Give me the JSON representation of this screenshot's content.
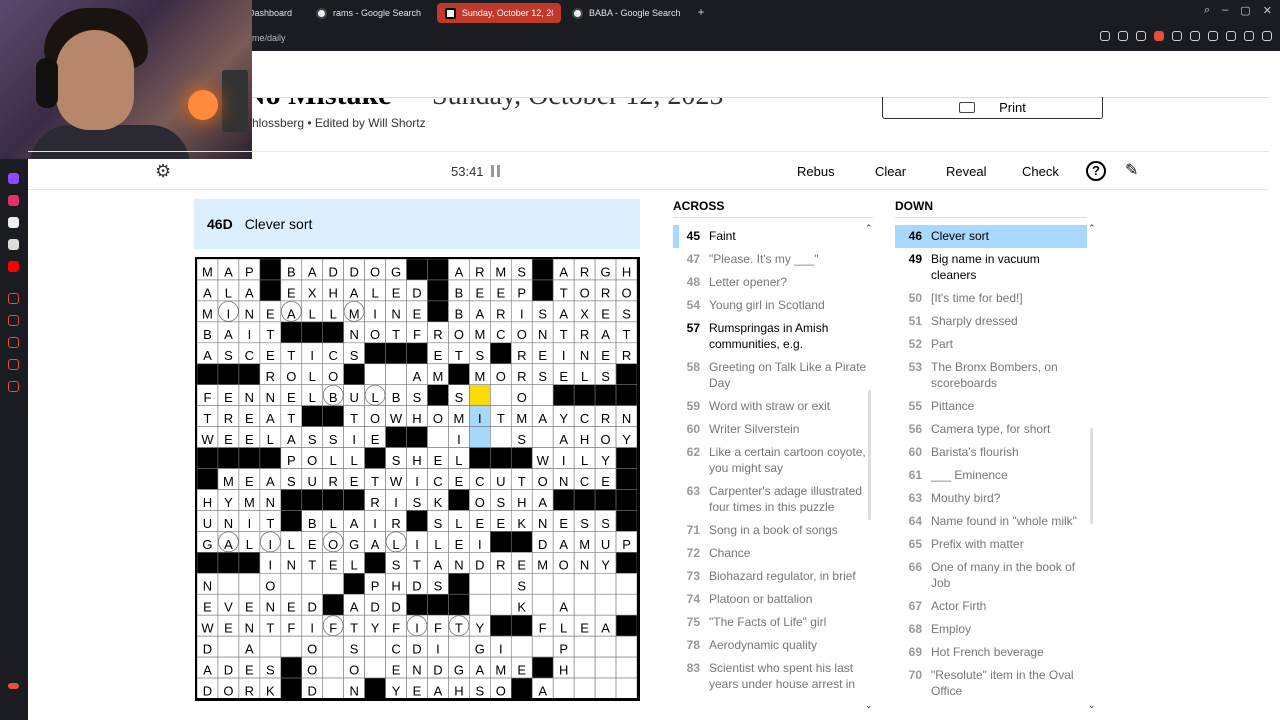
{
  "browser": {
    "tabs": [
      {
        "label": "Dashboard",
        "active": false
      },
      {
        "label": "rams - Google Search",
        "active": false
      },
      {
        "label": "Sunday, October 12, 2025",
        "active": true
      },
      {
        "label": "BABA - Google Search",
        "active": false
      }
    ],
    "url": "me/daily"
  },
  "puzzle": {
    "title": "No Mistake",
    "date": "Sunday, October 12, 2025",
    "byline": "hlossberg  •  Edited by Will Shortz",
    "print_label": "Print"
  },
  "toolbar": {
    "timer": "53:41",
    "rebus": "Rebus",
    "clear": "Clear",
    "reveal": "Reveal",
    "check": "Check",
    "help": "?"
  },
  "current_clue": {
    "number": "46D",
    "text": "Clever sort"
  },
  "grid_rows": [
    "MAP#BADDOG##ARMS#ARGH",
    "ALA#EXHALED#BEEP#TORO",
    "MINEALLMINE#BARISAXES",
    "BAIT###NOTFROMCONTRATE",
    "ASCETICS####ETS#REINER",
    "#####ROLO#####AM#MORSELS",
    "FENNELBULBS#S##O#######",
    "TREAT##TOWHOMITMAYCRN#",
    "WEELASSIE###I##S#AHOY",
    "###POLL#SHEL###WILY#",
    "#MEASURETWICECUTONCE#",
    "HYMN####RISK#OSHA###",
    "UNIT#BLAIR#SLEEKNESS",
    "GALILEOGALILEI##DAMUP",
    "###INTEL#STANDREMONY#",
    "N##O#######PHDS##S####",
    "EVENED#ADD########K#A##",
    "WENTFIFTYFIFTY####FLEA",
    "D##A###O##O####CDI#GI##P",
    "ADES#O#O#ENDGAME#H##",
    "DORK#D##N#YEAHSO#A###"
  ],
  "grid": {
    "letters": [
      [
        "M",
        "A",
        "P",
        "#",
        "B",
        "A",
        "D",
        "D",
        "O",
        "G",
        "#",
        "#",
        "A",
        "R",
        "M",
        "S",
        "#",
        "A",
        "R",
        "G",
        "H"
      ],
      [
        "A",
        "L",
        "A",
        "#",
        "E",
        "X",
        "H",
        "A",
        "L",
        "E",
        "D",
        "#",
        "B",
        "E",
        "E",
        "P",
        "#",
        "T",
        "O",
        "R",
        "O"
      ],
      [
        "M",
        "I",
        "N",
        "E",
        "A",
        "L",
        "L",
        "M",
        "I",
        "N",
        "E",
        "#",
        "B",
        "A",
        "R",
        "I",
        "S",
        "A",
        "X",
        "E",
        "S"
      ],
      [
        "B",
        "A",
        "I",
        "T",
        "#",
        "#",
        "#",
        "N",
        "O",
        "T",
        "F",
        "R",
        "O",
        "M",
        "C",
        "O",
        "N",
        "T",
        "R",
        "A",
        "T",
        "E"
      ],
      [
        "A",
        "S",
        "C",
        "E",
        "T",
        "I",
        "C",
        "S",
        "#",
        "#",
        "#",
        "E",
        "T",
        "S",
        "#",
        "R",
        "E",
        "I",
        "N",
        "E",
        "R"
      ],
      [
        "#",
        "#",
        "#",
        "R",
        "O",
        "L",
        "O",
        "#",
        "",
        "",
        "A",
        "M",
        "#",
        "M",
        "O",
        "R",
        "S",
        "E",
        "L",
        "S",
        "#"
      ],
      [
        "F",
        "E",
        "N",
        "N",
        "E",
        "L",
        "B",
        "U",
        "L",
        "B",
        "S",
        "#",
        "S",
        "",
        "",
        "O",
        "",
        "#",
        "#",
        "#",
        "#"
      ],
      [
        "T",
        "R",
        "E",
        "A",
        "T",
        "#",
        "#",
        "T",
        "O",
        "W",
        "H",
        "O",
        "M",
        "I",
        "T",
        "M",
        "A",
        "Y",
        "C",
        "R",
        "N"
      ],
      [
        "W",
        "E",
        "E",
        "L",
        "A",
        "S",
        "S",
        "I",
        "E",
        "#",
        "#",
        "",
        "I",
        "",
        "",
        "S",
        "",
        "A",
        "H",
        "O",
        "Y"
      ],
      [
        "#",
        "#",
        "#",
        "#",
        "P",
        "O",
        "L",
        "L",
        "#",
        "S",
        "H",
        "E",
        "L",
        "#",
        "#",
        "#",
        "W",
        "I",
        "L",
        "Y",
        "#"
      ],
      [
        "#",
        "M",
        "E",
        "A",
        "S",
        "U",
        "R",
        "E",
        "T",
        "W",
        "I",
        "C",
        "E",
        "C",
        "U",
        "T",
        "O",
        "N",
        "C",
        "E",
        "#"
      ],
      [
        "H",
        "Y",
        "M",
        "N",
        "#",
        "#",
        "#",
        "#",
        "R",
        "I",
        "S",
        "K",
        "#",
        "O",
        "S",
        "H",
        "A",
        "#",
        "#",
        "#",
        "#"
      ],
      [
        "U",
        "N",
        "I",
        "T",
        "#",
        "B",
        "L",
        "A",
        "I",
        "R",
        "#",
        "S",
        "L",
        "E",
        "E",
        "K",
        "N",
        "E",
        "S",
        "S",
        "#"
      ],
      [
        "G",
        "A",
        "L",
        "I",
        "L",
        "E",
        "O",
        "G",
        "A",
        "L",
        "I",
        "L",
        "E",
        "I",
        "#",
        "#",
        "D",
        "A",
        "M",
        "U",
        "P"
      ],
      [
        "#",
        "#",
        "#",
        "I",
        "N",
        "T",
        "E",
        "L",
        "#",
        "S",
        "T",
        "A",
        "N",
        "D",
        "R",
        "E",
        "M",
        "O",
        "N",
        "Y",
        "#"
      ],
      [
        "N",
        "",
        "",
        "O",
        "",
        "",
        "",
        "#",
        "P",
        "H",
        "D",
        "S",
        "#",
        "",
        "",
        "S",
        "",
        "",
        "",
        "",
        ""
      ],
      [
        "E",
        "V",
        "E",
        "N",
        "E",
        "D",
        "#",
        "A",
        "D",
        "D",
        "#",
        "#",
        "#",
        "",
        "",
        "K",
        "",
        "A",
        "",
        "",
        ""
      ],
      [
        "W",
        "E",
        "N",
        "T",
        "F",
        "I",
        "F",
        "T",
        "Y",
        "F",
        "I",
        "F",
        "T",
        "Y",
        "#",
        "#",
        "F",
        "L",
        "E",
        "A",
        "#"
      ],
      [
        "D",
        "",
        "A",
        "",
        "",
        "O",
        "",
        "S",
        "",
        "C",
        "D",
        "I",
        "",
        "G",
        "I",
        "",
        "",
        "P",
        "",
        "",
        ""
      ],
      [
        "A",
        "D",
        "E",
        "S",
        "#",
        "O",
        "",
        "O",
        "",
        "E",
        "N",
        "D",
        "G",
        "A",
        "M",
        "E",
        "#",
        "H",
        "",
        "",
        ""
      ],
      [
        "D",
        "O",
        "R",
        "K",
        "#",
        "D",
        "",
        "N",
        "#",
        "Y",
        "E",
        "A",
        "H",
        "S",
        "O",
        "#",
        "A",
        "",
        "",
        "",
        ""
      ]
    ]
  },
  "across": {
    "header": "ACROSS",
    "clues": [
      {
        "n": "45",
        "t": "Faint",
        "state": "cross"
      },
      {
        "n": "47",
        "t": "\"Please. It's my ___\"",
        "state": ""
      },
      {
        "n": "48",
        "t": "Letter opener?",
        "state": ""
      },
      {
        "n": "54",
        "t": "Young girl in Scotland",
        "state": ""
      },
      {
        "n": "57",
        "t": "Rumspringas in Amish communities, e.g.",
        "state": "done"
      },
      {
        "n": "58",
        "t": "Greeting on Talk Like a Pirate Day",
        "state": ""
      },
      {
        "n": "59",
        "t": "Word with straw or exit",
        "state": ""
      },
      {
        "n": "60",
        "t": "Writer Silverstein",
        "state": ""
      },
      {
        "n": "62",
        "t": "Like a certain cartoon coyote, you might say",
        "state": ""
      },
      {
        "n": "63",
        "t": "Carpenter's adage illustrated four times in this puzzle",
        "state": ""
      },
      {
        "n": "71",
        "t": "Song in a book of songs",
        "state": ""
      },
      {
        "n": "72",
        "t": "Chance",
        "state": ""
      },
      {
        "n": "73",
        "t": "Biohazard regulator, in brief",
        "state": ""
      },
      {
        "n": "74",
        "t": "Platoon or battalion",
        "state": ""
      },
      {
        "n": "75",
        "t": "\"The Facts of Life\" girl",
        "state": ""
      },
      {
        "n": "78",
        "t": "Aerodynamic quality",
        "state": ""
      },
      {
        "n": "83",
        "t": "Scientist who spent his last years under house arrest in",
        "state": ""
      }
    ]
  },
  "down": {
    "header": "DOWN",
    "clues": [
      {
        "n": "46",
        "t": "Clever sort",
        "state": "sel"
      },
      {
        "n": "49",
        "t": "Big name in vacuum cleaners",
        "state": "done"
      },
      {
        "n": "50",
        "t": "[It's time for bed!]",
        "state": ""
      },
      {
        "n": "51",
        "t": "Sharply dressed",
        "state": ""
      },
      {
        "n": "52",
        "t": "Part",
        "state": ""
      },
      {
        "n": "53",
        "t": "The Bronx Bombers, on scoreboards",
        "state": ""
      },
      {
        "n": "55",
        "t": "Pittance",
        "state": ""
      },
      {
        "n": "56",
        "t": "Camera type, for short",
        "state": ""
      },
      {
        "n": "60",
        "t": "Barista's flourish",
        "state": ""
      },
      {
        "n": "61",
        "t": "___ Eminence",
        "state": ""
      },
      {
        "n": "63",
        "t": "Mouthy bird?",
        "state": ""
      },
      {
        "n": "64",
        "t": "Name found in \"whole milk\"",
        "state": ""
      },
      {
        "n": "65",
        "t": "Prefix with matter",
        "state": ""
      },
      {
        "n": "66",
        "t": "One of many in the book of Job",
        "state": ""
      },
      {
        "n": "67",
        "t": "Actor Firth",
        "state": ""
      },
      {
        "n": "68",
        "t": "Employ",
        "state": ""
      },
      {
        "n": "69",
        "t": "Hot French beverage",
        "state": ""
      },
      {
        "n": "70",
        "t": "\"Resolute\" item in the Oval Office",
        "state": ""
      }
    ]
  },
  "colors": {
    "selected_cell": "#ffda00",
    "selected_word": "#a7d8ff",
    "clue_bar": "#dcefff",
    "active_tab": "#c0392b"
  },
  "icons": {
    "settings": "gear-icon",
    "pause": "pause-icon",
    "help": "help-icon",
    "pencil": "pencil-icon",
    "print": "printer-icon"
  }
}
